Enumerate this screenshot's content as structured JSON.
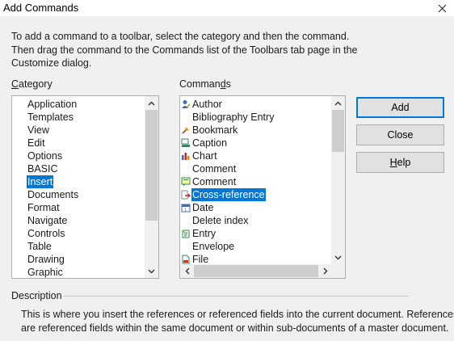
{
  "window": {
    "title": "Add Commands"
  },
  "intro": {
    "lines": [
      "To add a command to a toolbar, select the category and then the command.",
      "Then drag the command to the Commands list of the Toolbars tab page in the",
      "Customize dialog."
    ]
  },
  "category": {
    "label_first": "C",
    "label_rest": "ategory",
    "items": [
      "Application",
      "Templates",
      "View",
      "Edit",
      "Options",
      "BASIC",
      "Insert",
      "Documents",
      "Format",
      "Navigate",
      "Controls",
      "Table",
      "Drawing",
      "Graphic"
    ],
    "selected": "Insert"
  },
  "commands": {
    "label_pre": "Comman",
    "label_u": "d",
    "label_post": "s",
    "items": [
      {
        "label": "Author",
        "icon": "author-icon"
      },
      {
        "label": "Bibliography Entry",
        "icon": ""
      },
      {
        "label": "Bookmark",
        "icon": "bookmark-icon"
      },
      {
        "label": "Caption",
        "icon": "caption-icon"
      },
      {
        "label": "Chart",
        "icon": "chart-icon"
      },
      {
        "label": "Comment",
        "icon": ""
      },
      {
        "label": "Comment",
        "icon": "comment-icon"
      },
      {
        "label": "Cross-reference",
        "icon": "cross-reference-icon"
      },
      {
        "label": "Date",
        "icon": "date-icon"
      },
      {
        "label": "Delete index",
        "icon": ""
      },
      {
        "label": "Entry",
        "icon": "entry-icon"
      },
      {
        "label": "Envelope",
        "icon": ""
      },
      {
        "label": "File",
        "icon": "file-icon"
      }
    ],
    "selected": "Cross-reference"
  },
  "buttons": {
    "add": "Add",
    "close": "Close",
    "help_u": "H",
    "help_rest": "elp"
  },
  "description": {
    "label": "Description",
    "lines": [
      "This is where you insert the references or referenced fields into the current document. References",
      "are referenced fields within the same document or within sub-documents of a master document."
    ]
  },
  "colors": {
    "selection": "#0078d7",
    "default_button_border": "#0078d7"
  }
}
